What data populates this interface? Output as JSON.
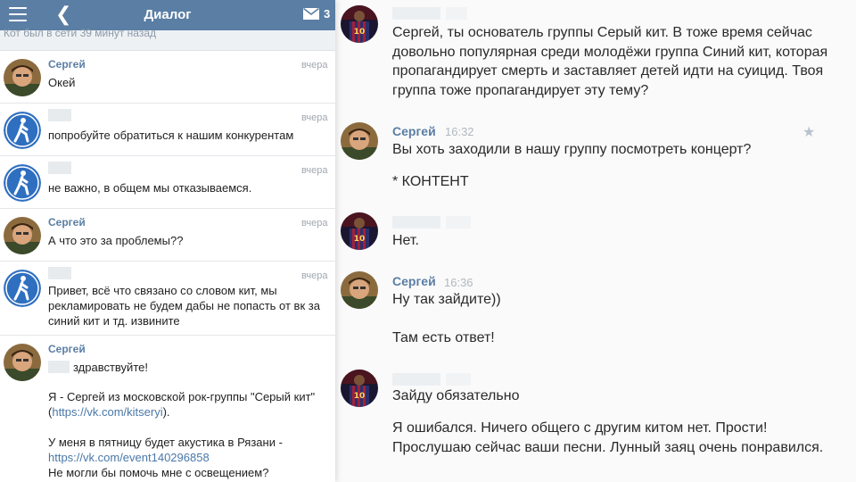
{
  "left": {
    "header": {
      "title": "Диалог",
      "mail_count": "3",
      "icons": [
        "menu-icon",
        "back-arrow-icon",
        "envelope-icon"
      ]
    },
    "last_seen": "Кот был в сети 39 минут назад",
    "messages": [
      {
        "name": "Сергей",
        "time": "вчера",
        "text": "Окей"
      },
      {
        "name": "",
        "time": "вчера",
        "text": "попробуйте обратиться к нашим конкурентам"
      },
      {
        "name": "",
        "time": "вчера",
        "text": "не важно, в общем мы отказываемся."
      },
      {
        "name": "Сергей",
        "time": "вчера",
        "text": "А что это за проблемы??"
      },
      {
        "name": "",
        "time": "вчера",
        "text": "Привет, всё что связано со словом кит, мы рекламировать не будем дабы не попасть от вк за синий кит и тд. извините"
      },
      {
        "name": "Сергей",
        "time": "",
        "greeting": "здравствуйте!",
        "para1_a": "Я - Сергей из московской рок-группы \"Серый кит\" (",
        "para1_link": "https://vk.com/kitseryi",
        "para1_b": ").",
        "para2_a": "У меня в пятницу будет акустика в Рязани -",
        "para2_link": "https://vk.com/event140296858",
        "para2_b": "Не могли бы помочь мне с освещением?"
      }
    ]
  },
  "right": {
    "messages": [
      {
        "name": "",
        "time": "",
        "lines": [
          "Сергей, ты основатель группы Серый кит. В тоже время сейчас довольно популярная среди молодёжи группа Синий кит, которая пропагандирует смерть и заставляет детей идти на суицид. Твоя группа тоже пропагандирует эту тему?"
        ]
      },
      {
        "name": "Сергей",
        "time": "16:32",
        "lines": [
          "Вы хоть заходили в нашу группу посмотреть концерт?",
          "* КОНТЕНТ"
        ]
      },
      {
        "name": "",
        "time": "",
        "lines": [
          "Нет."
        ]
      },
      {
        "name": "Сергей",
        "time": "16:36",
        "lines": [
          "Ну так зайдите))",
          "Там есть ответ!"
        ]
      },
      {
        "name": "",
        "time": "",
        "lines": [
          "Зайду обязательно",
          "Я ошибался. Ничего общего с другим китом нет. Прости! Прослушаю сейчас ваши песни. Лунный заяц очень понравился."
        ]
      }
    ]
  },
  "colors": {
    "header_bg": "#5a7ea4",
    "name": "#5a7ea4",
    "link": "#4a78a8",
    "time": "#a0a8b0"
  }
}
